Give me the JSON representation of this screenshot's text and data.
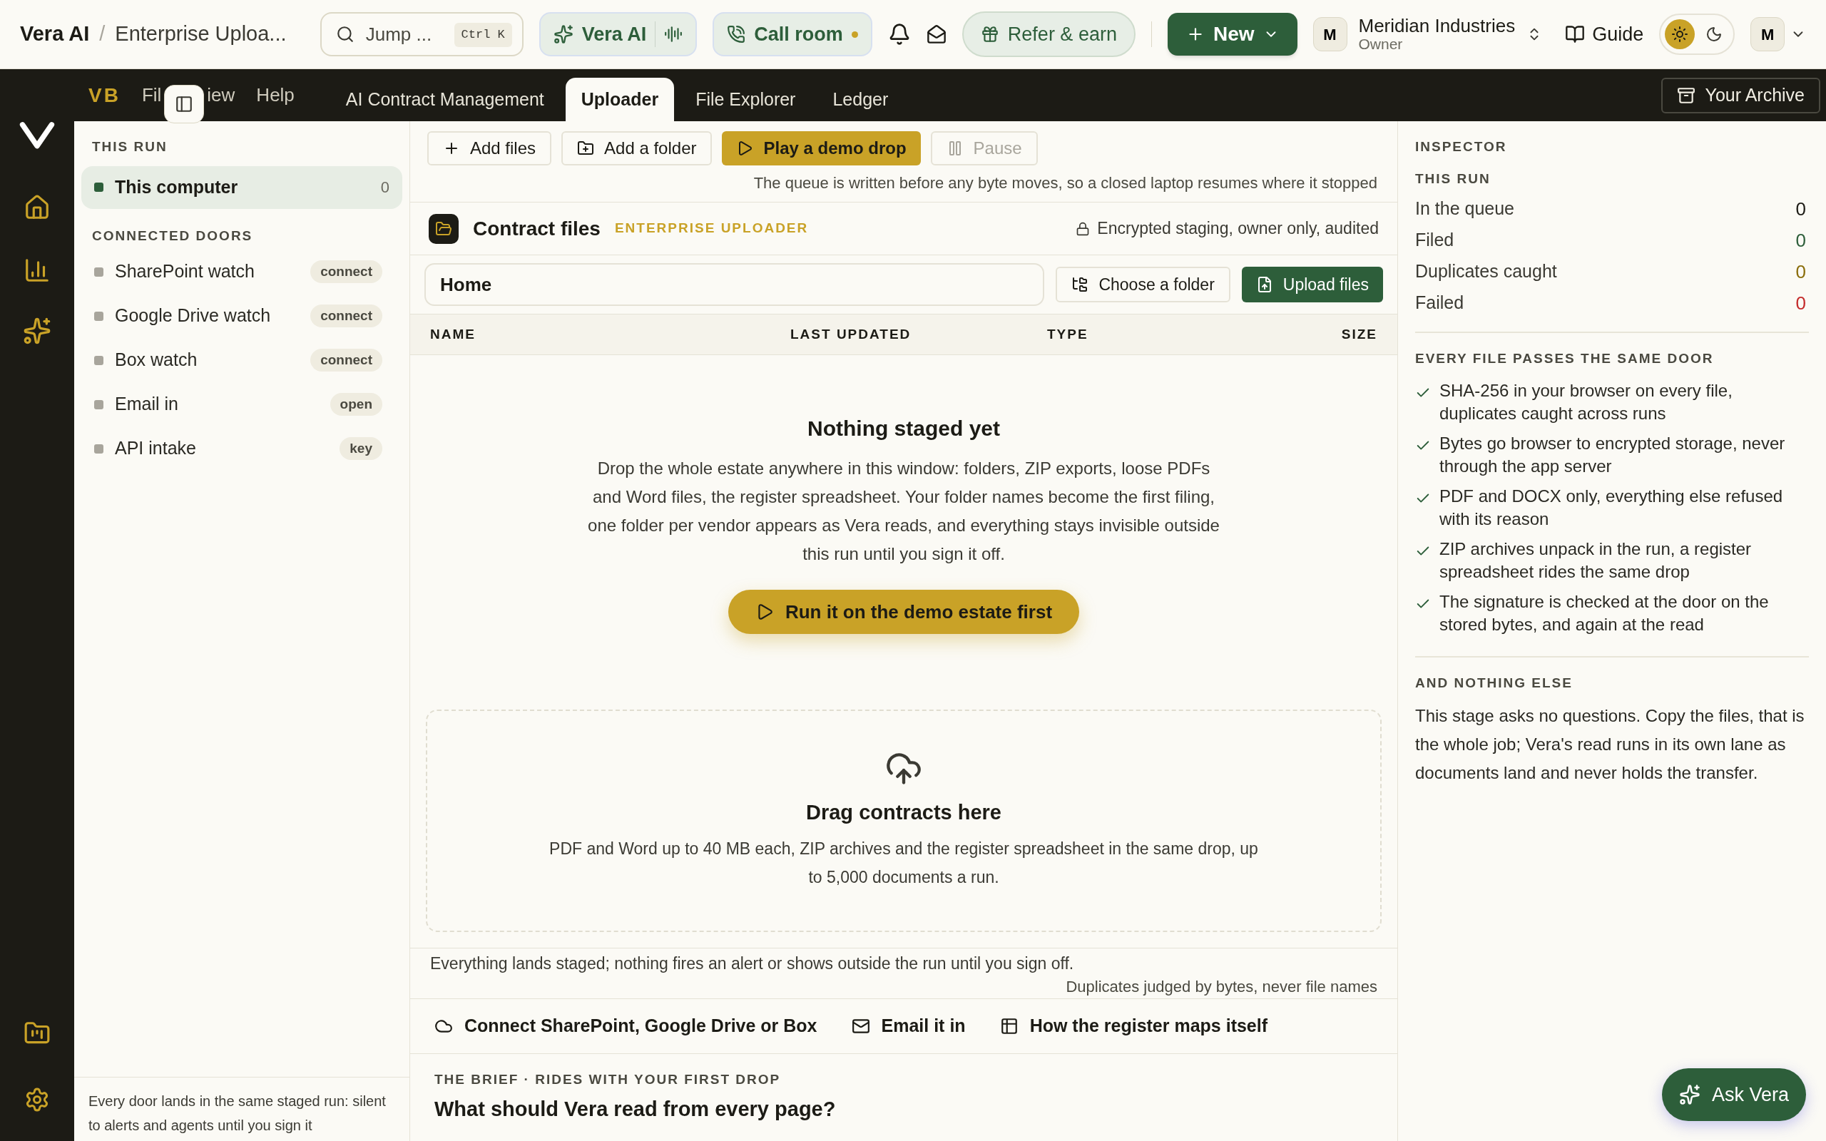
{
  "topbar": {
    "breadcrumb": [
      "Vera AI",
      "/",
      "Enterprise Uploa..."
    ],
    "search": {
      "placeholder": "Jump ...",
      "shortcut": "Ctrl K"
    },
    "vera_button": "Vera AI",
    "call_button": {
      "label": "Call room",
      "live": true
    },
    "refer_button": "Refer & earn",
    "new_button": "New",
    "org": {
      "avatar": "M",
      "name": "Meridian Industries",
      "role": "Owner"
    },
    "guide": "Guide",
    "theme": [
      {
        "kind": "light",
        "selected": true
      },
      {
        "kind": "dark",
        "selected": false
      }
    ],
    "user_avatar": "M"
  },
  "menubar": {
    "logo": "VB",
    "menus": [
      "Fil",
      "iew",
      "Help"
    ],
    "tabs": [
      {
        "label": "AI Contract Management",
        "selected": false
      },
      {
        "label": "Uploader",
        "selected": true
      },
      {
        "label": "File Explorer",
        "selected": false
      },
      {
        "label": "Ledger",
        "selected": false
      }
    ],
    "archive_button": "Your Archive"
  },
  "sidebar": {
    "run_heading": "THIS RUN",
    "run_items": [
      {
        "label": "This computer",
        "count": "0",
        "selected": true,
        "color": "#2d5e3a"
      }
    ],
    "doors_heading": "CONNECTED DOORS",
    "doors": [
      {
        "label": "SharePoint watch",
        "badge": "connect",
        "selected": false,
        "color": "#a8a59c"
      },
      {
        "label": "Google Drive watch",
        "badge": "connect",
        "selected": false,
        "color": "#a8a59c"
      },
      {
        "label": "Box watch",
        "badge": "connect",
        "selected": false,
        "color": "#a8a59c"
      },
      {
        "label": "Email in",
        "badge": "open",
        "selected": false,
        "color": "#a8a59c"
      },
      {
        "label": "API intake",
        "badge": "key",
        "selected": false,
        "color": "#a8a59c"
      }
    ],
    "footer": "Every door lands in the same staged run: silent to alerts and agents until you sign it"
  },
  "toolbar": [
    {
      "kind": "add",
      "label": "Add files",
      "disabled": false
    },
    {
      "kind": "folder",
      "label": "Add a folder",
      "disabled": false
    },
    {
      "kind": "play",
      "label": "Play a demo drop",
      "disabled": false
    },
    {
      "kind": "pause",
      "label": "Pause",
      "disabled": true
    }
  ],
  "queue_note": "The queue is written before any byte moves, so a closed laptop resumes where it stopped",
  "panel": {
    "title": "Contract files",
    "tag": "ENTERPRISE UPLOADER",
    "security": "Encrypted staging, owner only, audited",
    "path": "Home",
    "choose_button": "Choose a folder",
    "upload_button": "Upload files",
    "columns": [
      "NAME",
      "LAST UPDATED",
      "TYPE",
      "SIZE"
    ]
  },
  "empty": {
    "title": "Nothing staged yet",
    "body": "Drop the whole estate anywhere in this window: folders, ZIP exports, loose PDFs and Word files, the register spreadsheet. Your folder names become the first filing, one folder per vendor appears as Vera reads, and everything stays invisible outside this run until you sign it off.",
    "button": "Run it on the demo estate first"
  },
  "dropzone": {
    "title": "Drag contracts here",
    "body": "PDF and Word up to 40 MB each, ZIP archives and the register spreadsheet in the same drop, up to 5,000 documents a run."
  },
  "notes": [
    "Everything lands staged; nothing fires an alert or shows outside the run until you sign off.",
    "Duplicates judged by bytes, never file names"
  ],
  "links": [
    {
      "kind": "cloud",
      "label": "Connect SharePoint, Google Drive or Box"
    },
    {
      "kind": "mail",
      "label": "Email it in"
    },
    {
      "kind": "table",
      "label": "How the register maps itself"
    }
  ],
  "brief": {
    "eyebrow": "THE BRIEF · RIDES WITH YOUR FIRST DROP",
    "question": "What should Vera read from every page?"
  },
  "inspector": {
    "heading": "INSPECTOR",
    "run_heading": "THIS RUN",
    "stats": [
      {
        "label": "In the queue",
        "value": "0",
        "color": "#1c1b15"
      },
      {
        "label": "Filed",
        "value": "0",
        "color": "#2d5e3a"
      },
      {
        "label": "Duplicates caught",
        "value": "0",
        "color": "#8a6d0b"
      },
      {
        "label": "Failed",
        "value": "0",
        "color": "#c42b2b"
      }
    ],
    "door_heading": "EVERY FILE PASSES THE SAME DOOR",
    "checks": [
      "SHA-256 in your browser on every file, duplicates caught across runs",
      "Bytes go browser to encrypted storage, never through the app server",
      "PDF and DOCX only, everything else refused with its reason",
      "ZIP archives unpack in the run, a register spreadsheet rides the same drop",
      "The signature is checked at the door on the stored bytes, and again at the read"
    ],
    "else_heading": "AND NOTHING ELSE",
    "else_body": "This stage asks no questions. Copy the files, that is the whole job; Vera's read runs in its own lane as documents land and never holds the transfer."
  },
  "ask_button": "Ask Vera"
}
